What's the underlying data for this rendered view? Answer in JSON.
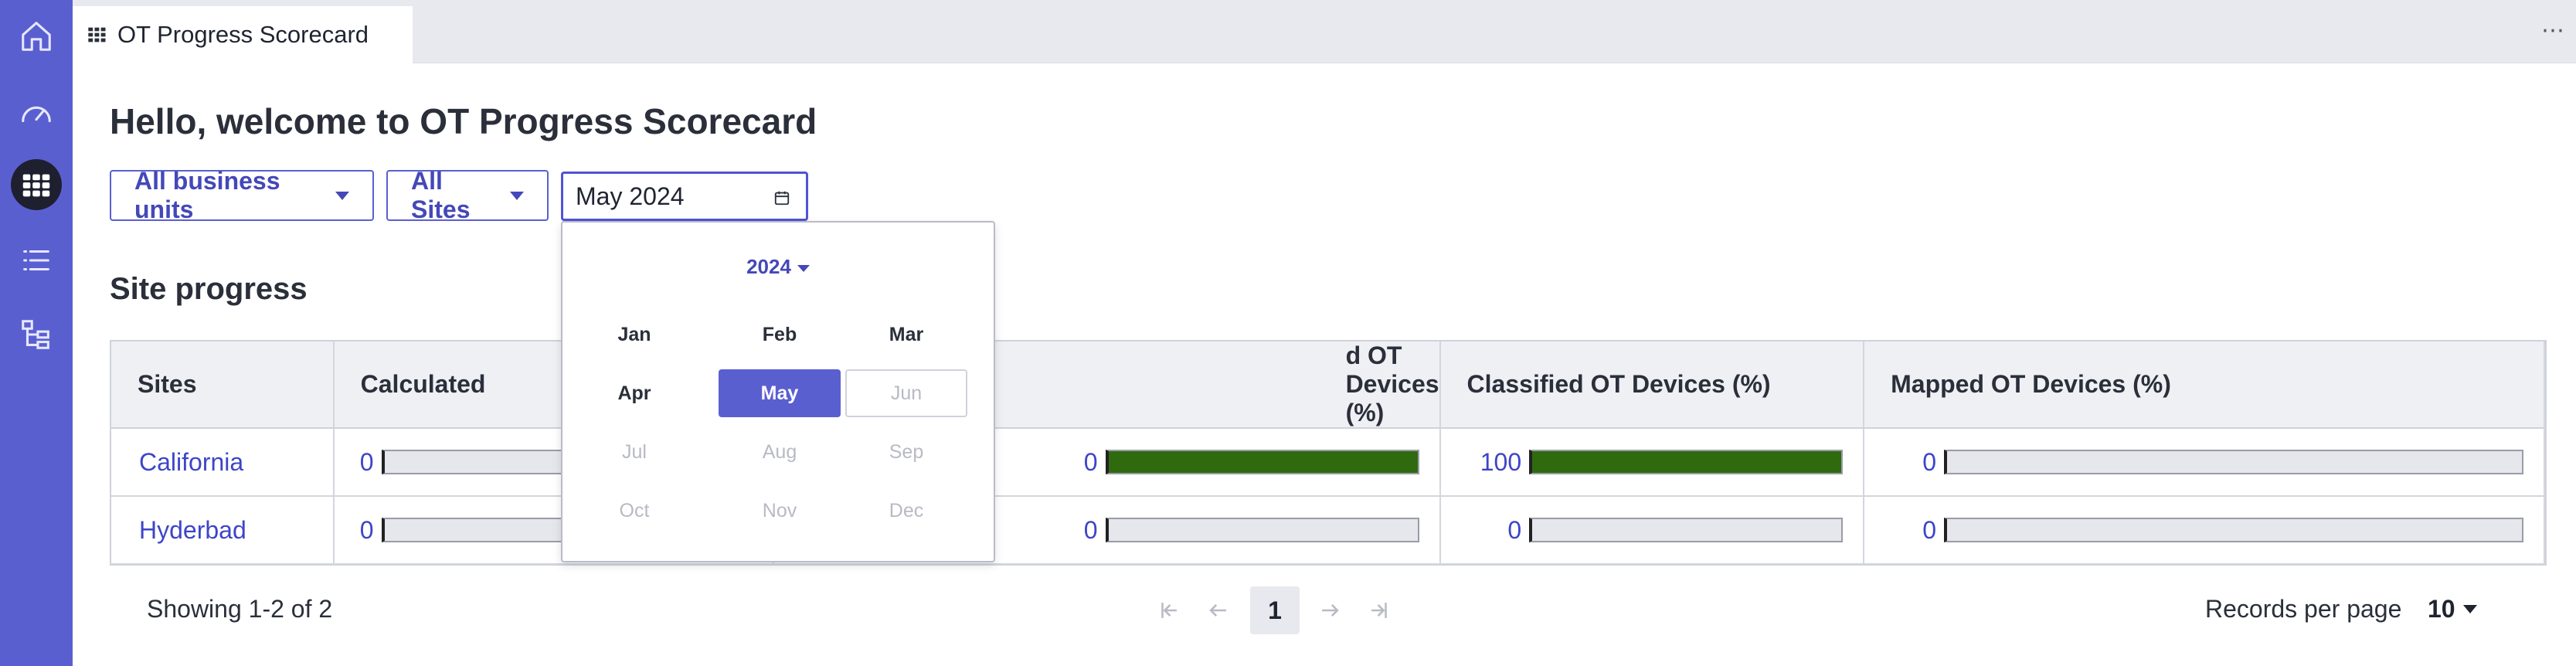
{
  "nav": {
    "items": [
      {
        "name": "home",
        "icon": "home-icon"
      },
      {
        "name": "dashboard",
        "icon": "speedometer-icon"
      },
      {
        "name": "scorecard",
        "icon": "grid-icon",
        "active": true
      },
      {
        "name": "list",
        "icon": "list-icon"
      },
      {
        "name": "hierarchy",
        "icon": "tree-icon"
      }
    ],
    "accent_color": "#5a5fd0"
  },
  "tab": {
    "title": "OT Progress Scorecard",
    "more_icon": "⋯"
  },
  "page": {
    "welcome": "Hello, welcome to OT Progress Scorecard"
  },
  "filters": {
    "business_units": "All business units",
    "sites": "All Sites",
    "date_value": "May 2024"
  },
  "section": {
    "title": "Site progress"
  },
  "table": {
    "headers": [
      "Sites",
      "Calculated",
      "d OT Devices (%)",
      "Classified OT Devices (%)",
      "Mapped OT Devices (%)"
    ],
    "rows": [
      {
        "site": "California",
        "calc": "0",
        "calc_pct": 0,
        "discovered": "0",
        "discovered_pct": 100,
        "classified": "100",
        "classified_pct": 100,
        "mapped": "0",
        "mapped_pct": 0
      },
      {
        "site": "Hyderbad",
        "calc": "0",
        "calc_pct": 0,
        "discovered": "0",
        "discovered_pct": 0,
        "classified": "0",
        "classified_pct": 0,
        "mapped": "0",
        "mapped_pct": 0
      }
    ]
  },
  "footer": {
    "showing": "Showing 1-2 of 2",
    "current_page": "1",
    "records_label": "Records per page",
    "records_value": "10"
  },
  "picker": {
    "year": "2024",
    "months": [
      {
        "label": "Jan",
        "state": "enabled"
      },
      {
        "label": "Feb",
        "state": "enabled"
      },
      {
        "label": "Mar",
        "state": "enabled"
      },
      {
        "label": "Apr",
        "state": "enabled"
      },
      {
        "label": "May",
        "state": "selected"
      },
      {
        "label": "Jun",
        "state": "today-disabled"
      },
      {
        "label": "Jul",
        "state": "disabled"
      },
      {
        "label": "Aug",
        "state": "disabled"
      },
      {
        "label": "Sep",
        "state": "disabled"
      },
      {
        "label": "Oct",
        "state": "disabled"
      },
      {
        "label": "Nov",
        "state": "disabled"
      },
      {
        "label": "Dec",
        "state": "disabled"
      }
    ]
  }
}
